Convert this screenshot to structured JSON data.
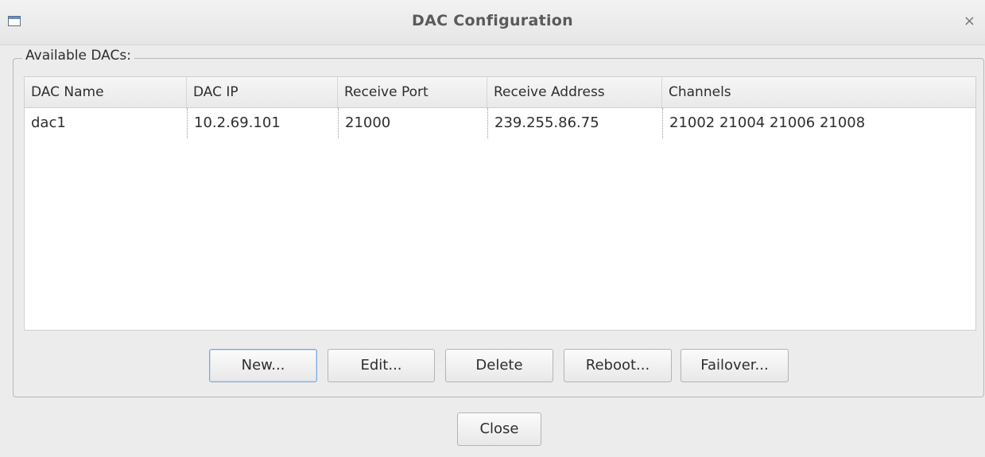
{
  "window": {
    "title": "DAC Configuration",
    "close_glyph": "×",
    "icon": "window-icon"
  },
  "group": {
    "legend": "Available DACs:"
  },
  "table": {
    "columns": [
      "DAC Name",
      "DAC IP",
      "Receive Port",
      "Receive Address",
      "Channels"
    ],
    "rows": [
      [
        "dac1",
        "10.2.69.101",
        "21000",
        "239.255.86.75",
        "21002 21004 21006 21008"
      ]
    ]
  },
  "buttons": {
    "new": "New...",
    "edit": "Edit...",
    "delete": "Delete",
    "reboot": "Reboot...",
    "failover": "Failover...",
    "close": "Close"
  },
  "colors": {
    "focus_border": "#7fa6d6",
    "window_bg": "#ececec"
  }
}
